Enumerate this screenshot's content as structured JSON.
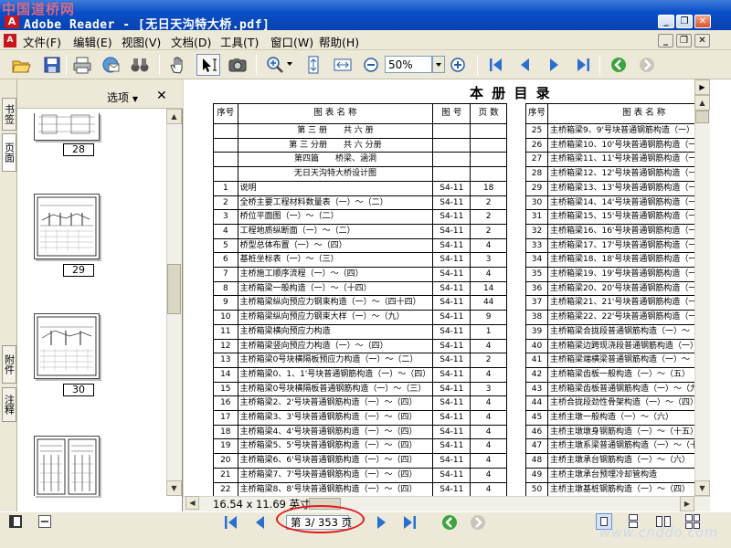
{
  "watermark_top": "中国道桥网",
  "watermark_bottom": "www.cnddo.com",
  "window": {
    "title": "Adobe Reader - [无日天沟特大桥.pdf]"
  },
  "menu": {
    "items": [
      "文件(F)",
      "编辑(E)",
      "视图(V)",
      "文档(D)",
      "工具(T)",
      "窗口(W)",
      "帮助(H)"
    ]
  },
  "toolbar": {
    "zoom_value": "50%"
  },
  "nav_tabs": [
    "书签",
    "页面",
    "附件",
    "注释"
  ],
  "panel": {
    "options_label": "选项",
    "thumbnails": [
      "28",
      "29",
      "30"
    ]
  },
  "status": {
    "page_size": "16.54 x 11.69 英寸",
    "page_indicator": "第 3/ 353 页"
  },
  "doc": {
    "title": "本 册 目 录",
    "left_headers": [
      "序号",
      "图 表 名 称",
      "图 号",
      "页 数"
    ],
    "left_section_rows": [
      "第 三 册　　共 六 册",
      "第 三 分册　　共 六 分册",
      "第四篇　　桥梁、涵洞",
      "无日天沟特大桥设计图"
    ],
    "left_rows": [
      [
        "1",
        "说明",
        "S4-11",
        "18"
      ],
      [
        "2",
        "全桥主要工程材料数量表（一）～（二）",
        "S4-11",
        "2"
      ],
      [
        "3",
        "桥位平面图（一）～（二）",
        "S4-11",
        "2"
      ],
      [
        "4",
        "工程地质纵断面（一）～（二）",
        "S4-11",
        "2"
      ],
      [
        "5",
        "桥型总体布置（一）～（四）",
        "S4-11",
        "4"
      ],
      [
        "6",
        "基桩坐标表（一）～（三）",
        "S4-11",
        "3"
      ],
      [
        "7",
        "主桥施工顺序流程（一）～（四）",
        "S4-11",
        "4"
      ],
      [
        "8",
        "主桥箱梁一般构造（一）～（十四）",
        "S4-11",
        "14"
      ],
      [
        "9",
        "主桥箱梁纵向预应力钢束构造（一）～（四十四）",
        "S4-11",
        "44"
      ],
      [
        "10",
        "主桥箱梁纵向预应力钢束大样（一）～（九）",
        "S4-11",
        "9"
      ],
      [
        "11",
        "主桥箱梁横向预应力构造",
        "S4-11",
        "1"
      ],
      [
        "12",
        "主桥箱梁竖向预应力构造（一）～（四）",
        "S4-11",
        "4"
      ],
      [
        "13",
        "主桥箱梁0号块横隔板预应力构造（一）～（二）",
        "S4-11",
        "2"
      ],
      [
        "14",
        "主桥箱梁0、1、1'号块普通钢筋构造（一）～（四）",
        "S4-11",
        "4"
      ],
      [
        "15",
        "主桥箱梁0号块横隔板普通钢筋构造（一）～（三）",
        "S4-11",
        "3"
      ],
      [
        "16",
        "主桥箱梁2、2'号块普通钢筋构造（一）～（四）",
        "S4-11",
        "4"
      ],
      [
        "17",
        "主桥箱梁3、3'号块普通钢筋构造（一）～（四）",
        "S4-11",
        "4"
      ],
      [
        "18",
        "主桥箱梁4、4'号块普通钢筋构造（一）～（四）",
        "S4-11",
        "4"
      ],
      [
        "19",
        "主桥箱梁5、5'号块普通钢筋构造（一）～（四）",
        "S4-11",
        "4"
      ],
      [
        "20",
        "主桥箱梁6、6'号块普通钢筋构造（一）～（四）",
        "S4-11",
        "4"
      ],
      [
        "21",
        "主桥箱梁7、7'号块普通钢筋构造（一）～（四）",
        "S4-11",
        "4"
      ],
      [
        "22",
        "主桥箱梁8、8'号块普通钢筋构造（一）～（四）",
        "S4-11",
        "4"
      ]
    ],
    "right_headers": [
      "序号",
      "图 表 名 称"
    ],
    "right_rows": [
      [
        "25",
        "主桥箱梁9、9'号块普通钢筋构造（一）～（四）"
      ],
      [
        "26",
        "主桥箱梁10、10'号块普通钢筋构造（一）～（四）"
      ],
      [
        "27",
        "主桥箱梁11、11'号块普通钢筋构造（一）～（四）"
      ],
      [
        "28",
        "主桥箱梁12、12'号块普通钢筋构造（一）～（四）"
      ],
      [
        "29",
        "主桥箱梁13、13'号块普通钢筋构造（一）～（四）"
      ],
      [
        "30",
        "主桥箱梁14、14'号块普通钢筋构造（一）～（四）"
      ],
      [
        "31",
        "主桥箱梁15、15'号块普通钢筋构造（一）～（四）"
      ],
      [
        "32",
        "主桥箱梁16、16'号块普通钢筋构造（一）～（四）"
      ],
      [
        "33",
        "主桥箱梁17、17'号块普通钢筋构造（一）～（四）"
      ],
      [
        "34",
        "主桥箱梁18、18'号块普通钢筋构造（一）～（四）"
      ],
      [
        "35",
        "主桥箱梁19、19'号块普通钢筋构造（一）～（四）"
      ],
      [
        "36",
        "主桥箱梁20、20'号块普通钢筋构造（一）～（四）"
      ],
      [
        "37",
        "主桥箱梁21、21'号块普通钢筋构造（一）～（四）"
      ],
      [
        "38",
        "主桥箱梁22、22'号块普通钢筋构造（一）～（四）"
      ],
      [
        "39",
        "主桥箱梁合拢段普通钢筋构造（一）～（二）"
      ],
      [
        "40",
        "主桥箱梁边跨现浇段普通钢筋构造（一）～（四）"
      ],
      [
        "41",
        "主桥箱梁端横梁普通钢筋构造（一）～（四）"
      ],
      [
        "42",
        "主桥箱梁齿板一般构造（一）～（五）"
      ],
      [
        "43",
        "主桥箱梁齿板普通钢筋构造（一）～（九）"
      ],
      [
        "44",
        "主桥合拢段劲性骨架构造（一）～（四）"
      ],
      [
        "45",
        "主桥主墩一般构造（一）～（六）"
      ],
      [
        "46",
        "主桥主墩墩身钢筋构造（一）～（十五）"
      ],
      [
        "47",
        "主桥主墩系梁普通钢筋构造（一）～（十二）"
      ],
      [
        "48",
        "主桥主墩承台钢筋构造（一）～（六）"
      ],
      [
        "49",
        "主桥主墩承台预埋冷却管构造"
      ],
      [
        "50",
        "主桥主墩基桩钢筋构造（一）～（四）"
      ]
    ]
  }
}
